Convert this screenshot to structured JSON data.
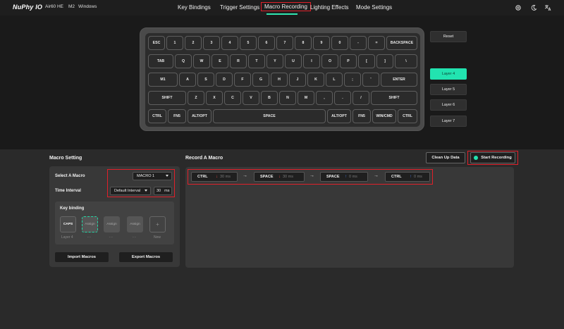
{
  "header": {
    "logo": "NuPhy IO",
    "model": "Air60 HE",
    "m2": "M2",
    "os": "Windows",
    "nav": [
      "Key Bindings",
      "Trigger Settings",
      "Macro Recording",
      "Lighting Effects",
      "Mode Settings"
    ],
    "active_nav": "Macro Recording",
    "icons": [
      "gear-icon",
      "moon-icon",
      "translate-icon"
    ],
    "accent": "#22e3b0",
    "highlight": "#e0202a"
  },
  "keyboard": {
    "rows": [
      [
        "ESC",
        "1",
        "2",
        "3",
        "4",
        "5",
        "6",
        "7",
        "8",
        "9",
        "0",
        "-",
        "=",
        "BACKSPACE"
      ],
      [
        "TAB",
        "Q",
        "W",
        "E",
        "R",
        "T",
        "Y",
        "U",
        "I",
        "O",
        "P",
        "[",
        "]",
        "\\"
      ],
      [
        "M1",
        "A",
        "S",
        "D",
        "F",
        "G",
        "H",
        "J",
        "K",
        "L",
        ";",
        "'",
        "ENTER"
      ],
      [
        "SHIFT",
        "Z",
        "X",
        "C",
        "V",
        "B",
        "N",
        "M",
        ",",
        ".",
        "/",
        "SHIFT"
      ],
      [
        "CTRL",
        "FN5",
        "ALT/OPT",
        "SPACE",
        "ALT/OPT",
        "FN5",
        "WIN/CMD",
        "CTRL"
      ]
    ]
  },
  "side": {
    "reset": "Reset",
    "layers": [
      "Layer 4",
      "Layer 5",
      "Layer 6",
      "Layer 7"
    ],
    "active_layer": "Layer 4"
  },
  "macro_setting": {
    "title": "Macro Setting",
    "select_label": "Select A Macro",
    "selected_macro": "MACRO 1",
    "interval_label": "Time Interval",
    "interval_mode": "Default Interval",
    "interval_value": "30",
    "interval_unit": "ms",
    "keybinding_title": "Key binding",
    "slots": [
      {
        "label": "CAPS",
        "sub": "Layer 4"
      },
      {
        "label": "Assign",
        "sub": "- -"
      },
      {
        "label": "Assign",
        "sub": "- -"
      },
      {
        "label": "Assign",
        "sub": "- -"
      },
      {
        "label": "+",
        "sub": "New"
      }
    ],
    "import": "Import Macros",
    "export": "Export Macros"
  },
  "record": {
    "title": "Record A Macro",
    "clear": "Clean Up Data",
    "start": "Start Recording",
    "steps": [
      {
        "key": "CTRL",
        "dir": "down",
        "ms": "30 ms"
      },
      {
        "key": "SPACE",
        "dir": "down",
        "ms": "30 ms"
      },
      {
        "key": "SPACE",
        "dir": "up",
        "ms": "0 ms"
      },
      {
        "key": "CTRL",
        "dir": "up",
        "ms": "0 ms"
      }
    ],
    "arrow": "→"
  }
}
